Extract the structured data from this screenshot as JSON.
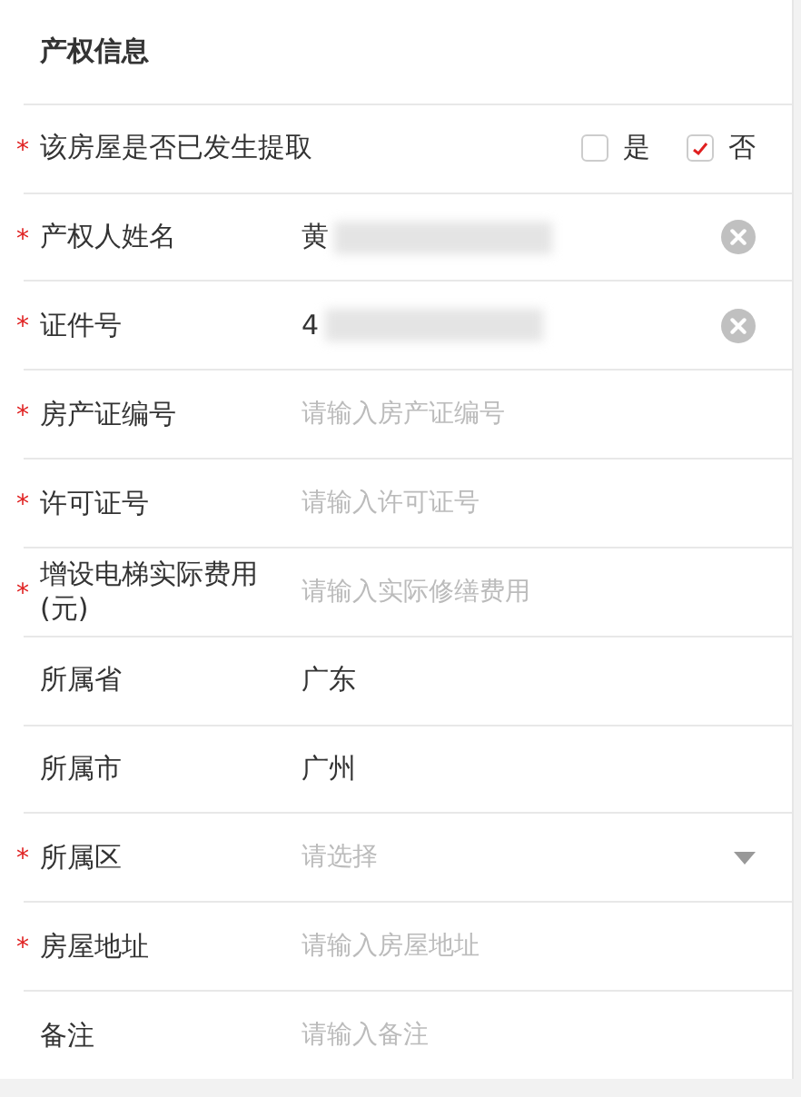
{
  "section_title": "产权信息",
  "rows": [
    {
      "kind": "choice",
      "label": "该房屋是否已发生提取",
      "asterisk": "*",
      "options": [
        {
          "label": "是",
          "checked": false
        },
        {
          "label": "否",
          "checked": true
        }
      ]
    },
    {
      "kind": "filled",
      "label": "产权人姓名",
      "asterisk": "*",
      "value": "黄",
      "blurred": true
    },
    {
      "kind": "filled",
      "label": "证件号",
      "asterisk": "*",
      "value": "4",
      "blurred": true
    },
    {
      "kind": "input",
      "label": "房产证编号",
      "asterisk": "*",
      "placeholder": "请输入房产证编号"
    },
    {
      "kind": "input",
      "label": "许可证号",
      "asterisk": "*",
      "placeholder": "请输入许可证号"
    },
    {
      "kind": "input",
      "label": "增设电梯实际费用(元)",
      "asterisk": "*",
      "placeholder": "请输入实际修缮费用"
    },
    {
      "kind": "static",
      "label": "所属省",
      "value": "广东"
    },
    {
      "kind": "static",
      "label": "所属市",
      "value": "广州"
    },
    {
      "kind": "select",
      "label": "所属区",
      "asterisk": "*",
      "placeholder": "请选择"
    },
    {
      "kind": "input",
      "label": "房屋地址",
      "asterisk": "*",
      "placeholder": "请输入房屋地址"
    },
    {
      "kind": "input",
      "label": "备注",
      "placeholder": "请输入备注"
    }
  ]
}
